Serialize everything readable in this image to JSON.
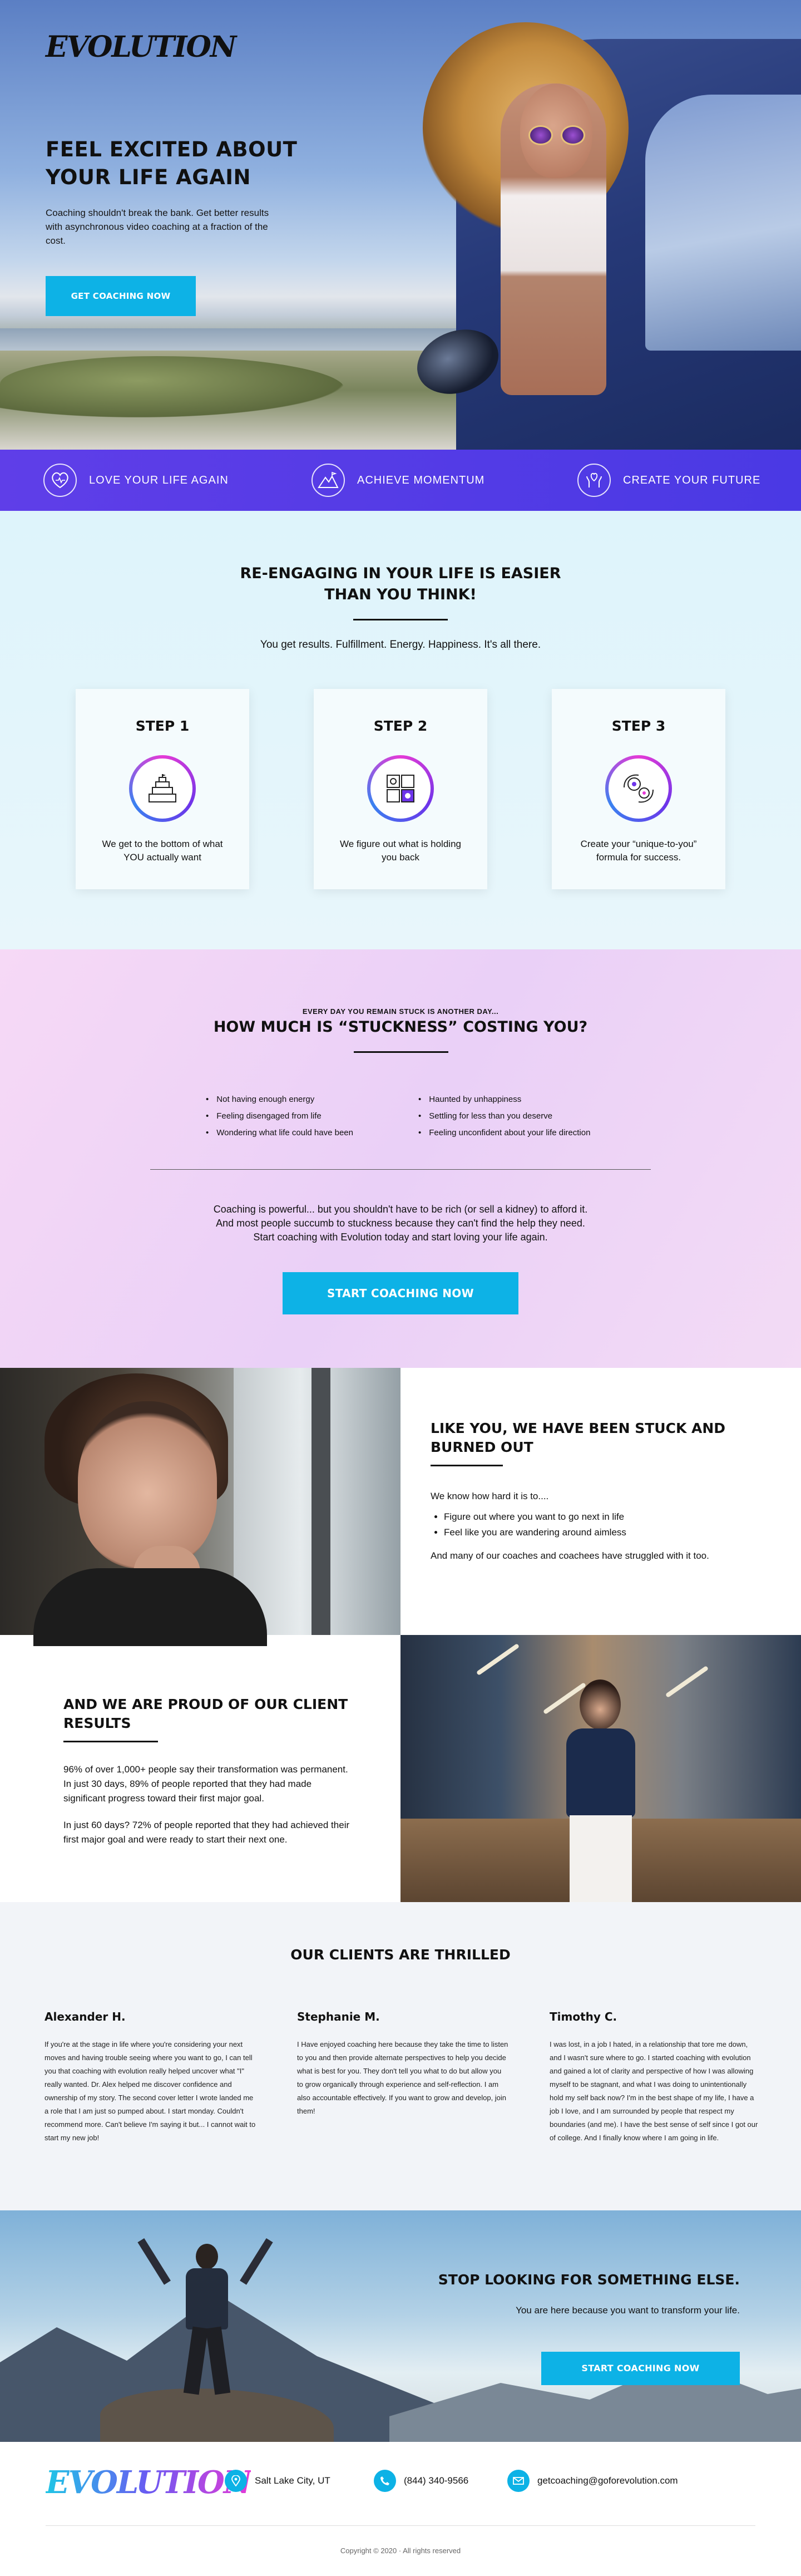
{
  "brand": {
    "logo_text": "EVOLUTION",
    "accent": "#0db2e6",
    "band_color": "#5a3de6"
  },
  "hero": {
    "title": "FEEL EXCITED ABOUT YOUR LIFE AGAIN",
    "text": "Coaching shouldn't break the bank. Get better results with asynchronous video coaching at a fraction of the cost.",
    "button": "GET COACHING NOW"
  },
  "band": {
    "items": [
      {
        "icon": "heart-icon",
        "label": "LOVE YOUR LIFE AGAIN"
      },
      {
        "icon": "mountain-icon",
        "label": "ACHIEVE MOMENTUM"
      },
      {
        "icon": "hands-icon",
        "label": "CREATE YOUR FUTURE"
      }
    ]
  },
  "steps_section": {
    "title_line1": "RE-ENGAGING IN YOUR LIFE IS EASIER",
    "title_line2": "THAN YOU THINK!",
    "lead": "You get results. Fulfillment. Energy. Happiness. It's all there.",
    "steps": [
      {
        "title": "STEP 1",
        "icon": "pyramid-icon",
        "text": "We get to the bottom of what YOU actually want"
      },
      {
        "title": "STEP 2",
        "icon": "puzzle-icon",
        "text": "We figure out what is holding you back"
      },
      {
        "title": "STEP 3",
        "icon": "gears-icon",
        "text": "Create your “unique-to-you” formula for success."
      }
    ]
  },
  "stuck": {
    "kicker": "EVERY DAY YOU REMAIN STUCK IS ANOTHER DAY...",
    "title": "HOW MUCH IS “STUCKNESS” COSTING YOU?",
    "list_left": [
      "Not having enough energy",
      "Feeling disengaged from life",
      "Wondering what life could have been"
    ],
    "list_right": [
      "Haunted by unhappiness",
      "Settling for less than you deserve",
      "Feeling unconfident about your life direction"
    ],
    "para_line1": "Coaching is powerful... but you shouldn't have to be rich (or sell a kidney) to afford it.",
    "para_line2": "And most people succumb to stuckness because they can't find the help they need.",
    "para_line3": "Start coaching with Evolution today and start loving your life again.",
    "button": "START COACHING NOW"
  },
  "stuck_story": {
    "title": "LIKE YOU, WE HAVE BEEN STUCK AND BURNED OUT",
    "intro": "We know how hard it is to....",
    "bullets": [
      "Figure out where you want to go next in life",
      "Feel like you are wandering around aimless"
    ],
    "outro": "And many of our coaches and coachees have struggled with it too."
  },
  "results": {
    "title": "AND WE ARE PROUD OF OUR CLIENT RESULTS",
    "p1": "96% of over 1,000+ people say their transformation was permanent. In just 30 days, 89% of people reported that they had made significant progress toward their first major goal.",
    "p2": "In just 60 days? 72% of people reported that they had achieved their first major goal and were ready to start their next one."
  },
  "testimonials": {
    "title": "OUR CLIENTS ARE THRILLED",
    "items": [
      {
        "name": "Alexander H.",
        "text": "If you're at the stage in life where you're considering your next moves and having trouble seeing where you want to go, I can tell you that coaching with evolution really helped uncover what \"I\" really wanted. Dr. Alex helped me discover confidence and ownership of my story. The second cover letter I wrote landed me a role that I am just so pumped about. I start monday. Couldn't recommend more. Can't believe I'm saying it but... I cannot wait to start my new job!"
      },
      {
        "name": "Stephanie M.",
        "text": "I Have enjoyed coaching here because they take the time to listen to you and then provide alternate perspectives to help you decide what is best for you. They don't tell you what to do but allow you to grow organically through experience and self-reflection. I am also accountable effectively. If you want to grow and develop, join them!"
      },
      {
        "name": "Timothy C.",
        "text": "I was lost, in a job I hated, in a relationship that tore me down, and I wasn't sure where to go. I started coaching with evolution and gained a lot of clarity and perspective of how I was allowing myself to be stagnant, and what I was doing to unintentionally hold my self back now? I'm in the best shape of my life, I have a job I love, and I am surrounded by people that respect my boundaries (and me). I have the best sense of self since I got our of college. And I finally know where I am going in life."
      }
    ]
  },
  "cta": {
    "title": "STOP LOOKING FOR SOMETHING ELSE.",
    "text": "You are here because you want to transform your life.",
    "button": "START COACHING NOW"
  },
  "footer": {
    "logo_text": "EVOLUTION",
    "location": "Salt Lake City, UT",
    "phone": "(844) 340-9566",
    "email": "getcoaching@goforevolution.com",
    "copyright": "Copyright © 2020 · All rights reserved"
  }
}
